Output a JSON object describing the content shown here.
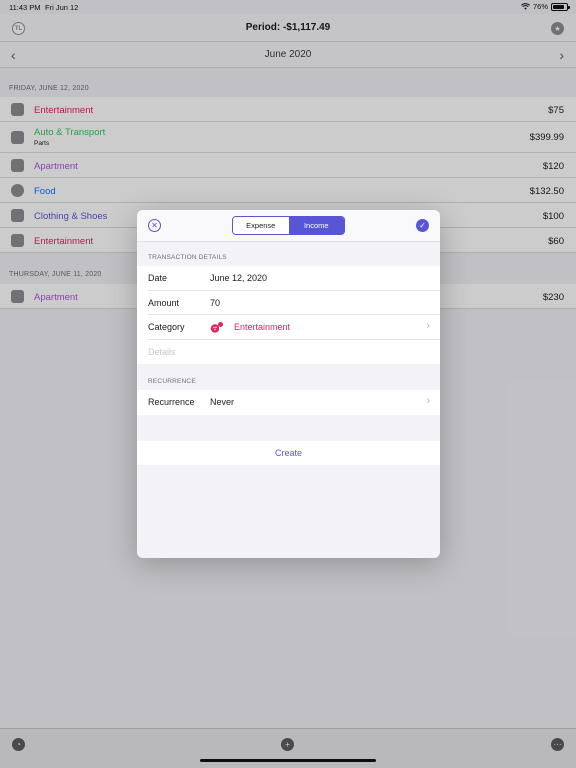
{
  "status": {
    "time": "11:43 PM",
    "date": "Fri Jun 12",
    "battery": "76%"
  },
  "nav": {
    "title": "Period: -$1,117.49",
    "left_icon_text": "TL",
    "month": "June 2020"
  },
  "sections": [
    {
      "header": "FRIDAY, JUNE 12, 2020",
      "rows": [
        {
          "name": "Entertainment",
          "color": "#e0245e",
          "amount": "$75"
        },
        {
          "name": "Auto & Transport",
          "sub": "Parts",
          "color": "#34c759",
          "amount": "$399.99"
        },
        {
          "name": "Apartment",
          "color": "#af52de",
          "amount": "$120"
        },
        {
          "name": "Food",
          "color": "#007aff",
          "amount": "$132.50"
        },
        {
          "name": "Clothing & Shoes",
          "color": "#5856d6",
          "amount": "$100"
        },
        {
          "name": "Entertainment",
          "color": "#e0245e",
          "amount": "$60"
        }
      ]
    },
    {
      "header": "THURSDAY, JUNE 11, 2020",
      "rows": [
        {
          "name": "Apartment",
          "color": "#af52de",
          "amount": "$230"
        }
      ]
    }
  ],
  "modal": {
    "segments": {
      "expense": "Expense",
      "income": "Income",
      "selected": "Income"
    },
    "details_header": "TRANSACTION DETAILS",
    "date_label": "Date",
    "date_value": "June 12, 2020",
    "amount_label": "Amount",
    "amount_value": "70",
    "category_label": "Category",
    "category_value": "Entertainment",
    "details_placeholder": "Details",
    "recurrence_header": "RECURRENCE",
    "recurrence_label": "Recurrence",
    "recurrence_value": "Never",
    "create_label": "Create"
  },
  "colors": {
    "accent": "#5856d6",
    "entertainment": "#e0245e"
  },
  "icons": [
    "close-circle-icon",
    "checkmark-circle-icon",
    "chevron-right-icon",
    "star-icon",
    "pie-chart-icon",
    "plus-circle-icon",
    "more-icon"
  ]
}
